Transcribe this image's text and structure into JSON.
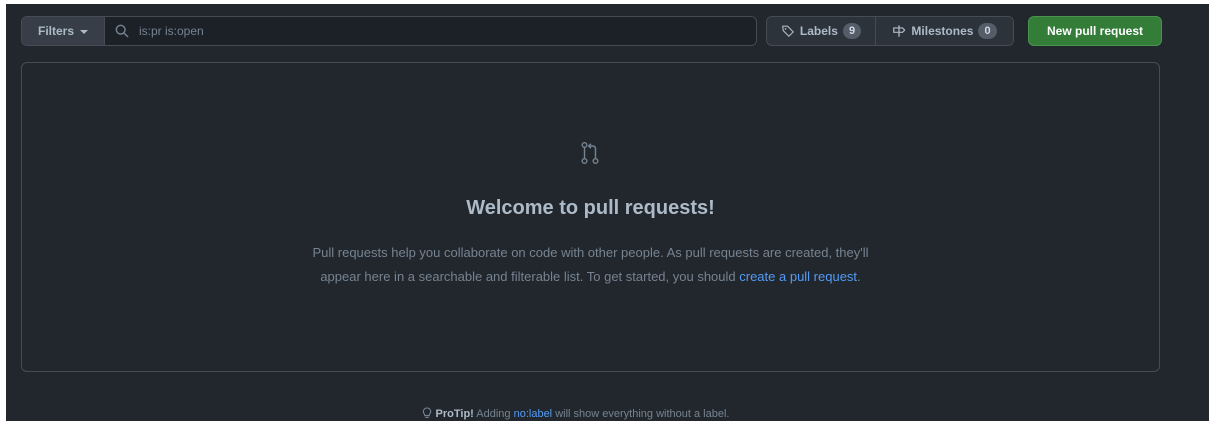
{
  "toolbar": {
    "filters_label": "Filters",
    "search_placeholder": "is:pr is:open",
    "search_value": "",
    "labels_label": "Labels",
    "labels_count": "9",
    "milestones_label": "Milestones",
    "milestones_count": "0",
    "new_pr_label": "New pull request"
  },
  "blankslate": {
    "heading": "Welcome to pull requests!",
    "line1": "Pull requests help you collaborate on code with other people. As pull requests are created, they'll",
    "line2_prefix": "appear here in a searchable and filterable list. To get started, you should ",
    "line2_link": "create a pull request",
    "line2_suffix": "."
  },
  "protip": {
    "bold": "ProTip!",
    "prefix": " Adding ",
    "link": "no:label",
    "suffix": " will show everything without a label."
  },
  "icons": {
    "search": "search-icon",
    "tag": "tag-icon",
    "milestone": "milestone-icon",
    "pull_request": "git-pull-request-icon",
    "light_bulb": "light-bulb-icon"
  },
  "colors": {
    "background": "#22272e",
    "accent_green": "#347d39",
    "link_blue": "#539bf5",
    "border": "#444c56"
  }
}
